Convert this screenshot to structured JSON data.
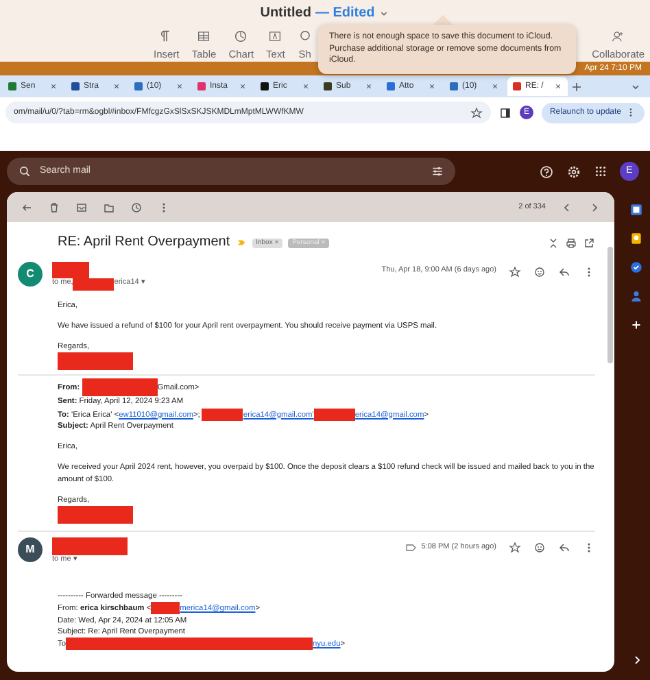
{
  "pages_window": {
    "title": "Untitled",
    "status": "— Edited",
    "toolbar": [
      {
        "label": "Insert",
        "kind": "pilcrow"
      },
      {
        "label": "Table",
        "kind": "table"
      },
      {
        "label": "Chart",
        "kind": "chart"
      },
      {
        "label": "Text",
        "kind": "textbox"
      },
      {
        "label": "Sh",
        "kind": "shape"
      },
      {
        "label": "Collaborate",
        "kind": "collaborate"
      }
    ],
    "popover": "There is not enough space to save this document to iCloud. Purchase additional storage or remove some documents from iCloud."
  },
  "menu_bar": {
    "clock": "Apr 24  7:10 PM"
  },
  "browser": {
    "tabs": [
      {
        "label": "Sen",
        "selected": false,
        "color": "#1e7b34"
      },
      {
        "label": "Stra",
        "selected": false,
        "color": "#1f4e9c"
      },
      {
        "label": "(10)",
        "selected": false,
        "color": "#2d6cc0"
      },
      {
        "label": "Insta",
        "selected": false,
        "color": "#e1306c"
      },
      {
        "label": "Eric",
        "selected": false,
        "color": "#111111"
      },
      {
        "label": "Sub",
        "selected": false,
        "color": "#3b3b22"
      },
      {
        "label": "Atto",
        "selected": false,
        "color": "#2a6fd6"
      },
      {
        "label": "(10)",
        "selected": false,
        "color": "#2d6cc0"
      },
      {
        "label": "RE: /",
        "selected": true,
        "color": "#d93025"
      }
    ],
    "address": "om/mail/u/0/?tab=rm&ogbl#inbox/FMfcgzGxSlSxSKJSKMDLmMptMLWWfKMW",
    "profile": "E",
    "relaunch": "Relaunch to update"
  },
  "gmail": {
    "search_placeholder": "Search mail",
    "profile": "E",
    "pager": "2 of 334",
    "subject": "RE: April Rent Overpayment",
    "labels": [
      "Inbox ×",
      "Personal ×"
    ],
    "messages": [
      {
        "avatar": "C",
        "color": "#138a72",
        "to": [
          {
            "kind": "text",
            "text": "to me, "
          },
          {
            "kind": "redacted"
          },
          {
            "kind": "text",
            "text": "erica14 ▾"
          }
        ],
        "time": "Thu, Apr 18, 9:00 AM (6 days ago)",
        "labelled": false,
        "lines": [
          {
            "kind": "para",
            "segments": [
              {
                "kind": "text",
                "text": "Erica,"
              }
            ]
          },
          {
            "kind": "para",
            "segments": [
              {
                "kind": "text",
                "text": "We have issued a refund of $100 for your April rent overpayment.  You should receive payment via USPS mail."
              }
            ]
          },
          {
            "kind": "para",
            "segments": [
              {
                "kind": "text",
                "text": "Regards,"
              }
            ]
          },
          {
            "kind": "line",
            "segments": [
              {
                "kind": "redacted"
              }
            ]
          },
          {
            "kind": "rule"
          },
          {
            "kind": "line",
            "segments": [
              {
                "kind": "text",
                "text": "**From:** "
              },
              {
                "kind": "redacted"
              },
              {
                "kind": "text",
                "text": "Gmail.com>"
              }
            ]
          },
          {
            "kind": "line",
            "segments": [
              {
                "kind": "text",
                "text": "**Sent:** Friday, April 12, 2024 9:23 AM"
              }
            ]
          },
          {
            "kind": "line",
            "segments": [
              {
                "kind": "text",
                "text": "**To:** 'Erica Erica' <"
              },
              {
                "kind": "link",
                "text": "ew11010@gmail.com"
              },
              {
                "kind": "text",
                "text": ">; "
              },
              {
                "kind": "redacted"
              },
              {
                "kind": "link",
                "text": "erica14@gmail.com'"
              },
              {
                "kind": "redacted"
              },
              {
                "kind": "link",
                "text": "erica14@gmail.com"
              },
              {
                "kind": "text",
                "text": ">"
              }
            ]
          },
          {
            "kind": "line",
            "segments": [
              {
                "kind": "text",
                "text": "**Subject:** April Rent Overpayment"
              }
            ]
          },
          {
            "kind": "para",
            "segments": [
              {
                "kind": "text",
                "text": "Erica,"
              }
            ]
          },
          {
            "kind": "para",
            "segments": [
              {
                "kind": "text",
                "text": "We received your April 2024 rent, however, you overpaid by $100. Once the deposit clears a $100 refund check will be issued and mailed back to you in the amount of $100."
              }
            ]
          },
          {
            "kind": "para",
            "segments": [
              {
                "kind": "text",
                "text": "Regards,"
              }
            ]
          },
          {
            "kind": "line",
            "segments": [
              {
                "kind": "redacted"
              }
            ]
          }
        ]
      },
      {
        "avatar": "M",
        "color": "#3c4d5a",
        "to": [
          {
            "kind": "text",
            "text": "to me ▾"
          }
        ],
        "time": "5:08 PM (2 hours ago)",
        "labelled": true,
        "lines": [
          {
            "kind": "gap",
            "segments": [
              {
                "kind": "text",
                "text": "---------- Forwarded message ---------"
              }
            ]
          },
          {
            "kind": "line",
            "segments": [
              {
                "kind": "text",
                "text": "From: **erica kirschbaum** <"
              },
              {
                "kind": "redacted"
              },
              {
                "kind": "link",
                "text": "merica14@gmail.com"
              },
              {
                "kind": "text",
                "text": ">"
              }
            ]
          },
          {
            "kind": "line",
            "segments": [
              {
                "kind": "text",
                "text": "Date: Wed, Apr 24, 2024 at 12:05 AM"
              }
            ]
          },
          {
            "kind": "line",
            "segments": [
              {
                "kind": "text",
                "text": "Subject: Re: April Rent Overpayment"
              }
            ]
          },
          {
            "kind": "line",
            "segments": [
              {
                "kind": "text",
                "text": "To"
              },
              {
                "kind": "redacted"
              },
              {
                "kind": "link",
                "text": "nyu.edu"
              },
              {
                "kind": "text",
                "text": ">"
              }
            ]
          }
        ]
      }
    ]
  }
}
